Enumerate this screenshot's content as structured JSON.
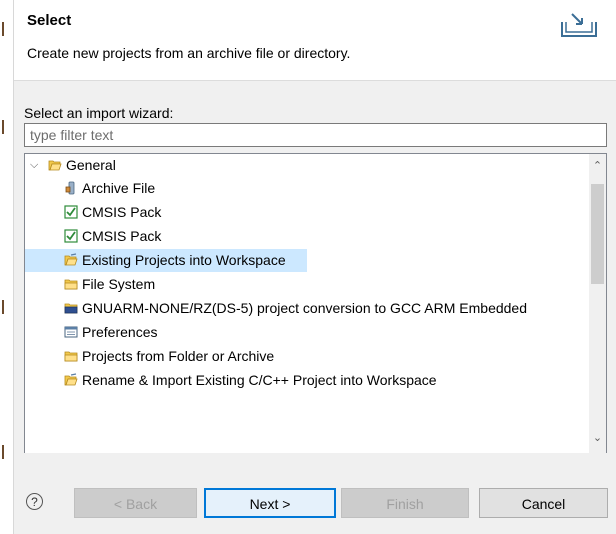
{
  "header": {
    "title": "Select",
    "description": "Create new projects from an archive file or directory."
  },
  "wizard": {
    "label": "Select an import wizard:",
    "filter_placeholder": "type filter text",
    "tree": {
      "root": {
        "label": "General",
        "expanded": true,
        "icon": "open-folder-icon"
      },
      "items": [
        {
          "label": "Archive File",
          "icon": "archive-file-icon"
        },
        {
          "label": "CMSIS Pack",
          "icon": "checkbox-icon"
        },
        {
          "label": "CMSIS Pack",
          "icon": "checkbox-icon"
        },
        {
          "label": "Existing Projects into Workspace",
          "icon": "project-folder-icon",
          "selected": true
        },
        {
          "label": "File System",
          "icon": "folder-icon"
        },
        {
          "label": "GNUARM-NONE/RZ(DS-5)  project conversion to GCC ARM Embedded",
          "icon": "conversion-folder-icon"
        },
        {
          "label": "Preferences",
          "icon": "preferences-icon"
        },
        {
          "label": "Projects from Folder or Archive",
          "icon": "folder-icon"
        },
        {
          "label": "Rename & Import Existing C/C++ Project into Workspace",
          "icon": "project-folder-icon"
        }
      ]
    }
  },
  "buttons": {
    "back": "< Back",
    "next": "Next >",
    "finish": "Finish",
    "cancel": "Cancel"
  },
  "colors": {
    "selection": "#cce8ff",
    "default_button_border": "#0078d7"
  }
}
